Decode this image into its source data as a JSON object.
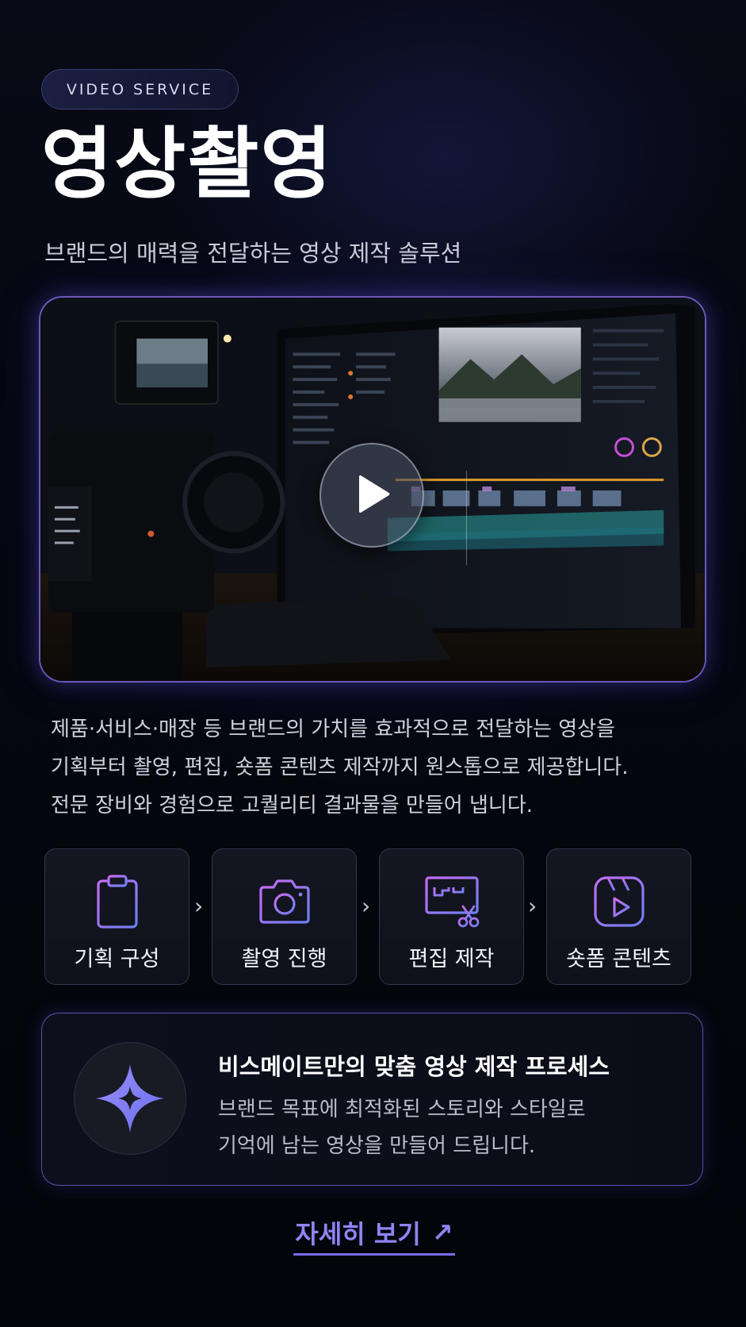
{
  "badge": {
    "label": "VIDEO SERVICE"
  },
  "hero": {
    "title": "영상촬영",
    "subtitle": "브랜드의 매력을 전달하는 영상 제작 솔루션"
  },
  "video": {
    "play_icon": "play-icon"
  },
  "description": {
    "lines": [
      "제품·서비스·매장 등 브랜드의 가치를 효과적으로 전달하는 영상을",
      "기획부터 촬영, 편집, 숏폼 콘텐츠 제작까지 원스톱으로 제공합니다.",
      "전문 장비와 경험으로 고퀄리티 결과물을 만들어 냅니다."
    ]
  },
  "steps": [
    {
      "label": "기획 구성",
      "icon": "clipboard-icon"
    },
    {
      "label": "촬영 진행",
      "icon": "camera-icon"
    },
    {
      "label": "편집 제작",
      "icon": "edit-monitor-icon"
    },
    {
      "label": "숏폼 콘텐츠",
      "icon": "short-video-icon"
    }
  ],
  "step_separator": "›",
  "process": {
    "icon": "sparkle-icon",
    "title": "비스메이트만의 맞춤 영상 제작 프로세스",
    "lines": [
      "브랜드 목표에 최적화된 스토리와 스타일로",
      "기억에 남는 영상을 만들어 드립니다."
    ]
  },
  "cta": {
    "label": "자세히 보기",
    "arrow": "↗"
  },
  "colors": {
    "background": "#05060d",
    "accent": "#8f84f5",
    "accent_gradient": [
      "#c06bf0",
      "#6a7cf2"
    ]
  }
}
